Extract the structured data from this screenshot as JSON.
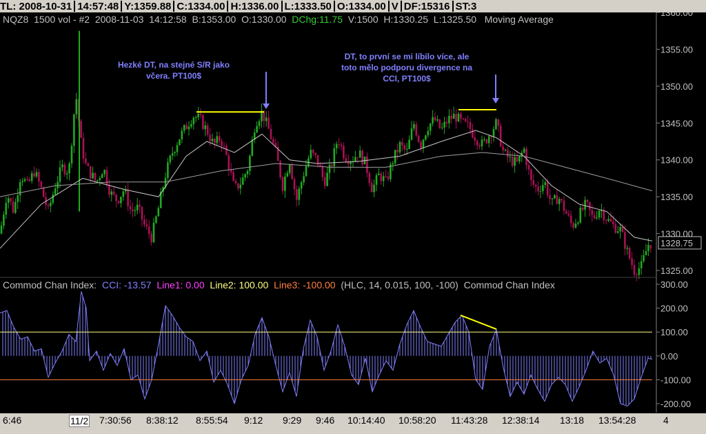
{
  "header": {
    "fields": [
      "TL: 2008-10-31",
      "14:57:48",
      "Y:1359.88",
      "C:1334.00",
      "H:1336.00",
      "L:1333.50",
      "O:1334.00",
      "V",
      "DF:15316",
      "ST:3"
    ]
  },
  "info": {
    "symbol": "NQZ8",
    "interval": "1500 vol - #2",
    "date": "2008-11-03",
    "time": "14:12:58",
    "bid": "B:1353.00",
    "open": "O:1330.00",
    "dchg": "DChg:11.75",
    "volume": "V:1500",
    "high": "H:1330.25",
    "low": "L:1325.50",
    "study": "Moving Average"
  },
  "cci_header": {
    "name": "Commod Chan Index:",
    "cci": "CCI: -13.57",
    "line1": "Line1: 0.00",
    "line2": "Line2: 100.00",
    "line3": "Line3: -100.00",
    "params": "(HLC, 14, 0.015, 100, -100)",
    "name2": "Commod Chan Index"
  },
  "annotations": {
    "left": [
      "Hezké DT, na stejné S/R jako",
      "včera. PT100$"
    ],
    "right": [
      "DT, to první se mi líbilo více, ale",
      "toto mělo podporu divergence na",
      "CCI, PT100$"
    ]
  },
  "colors": {
    "up": "#22aa22",
    "down": "#aa1155",
    "ma_fast": "#c8c8c8",
    "ma_slow": "#a0a0a0",
    "cci": "#8080ff",
    "line2": "#ffff80",
    "line3": "#ff8040",
    "annotation": "#8080ff",
    "dt_line": "#ffff00"
  },
  "chart_data": [
    {
      "type": "candlestick",
      "symbol": "NQZ8",
      "price_labels": [
        "1360.00",
        "1355.00",
        "1350.00",
        "1345.00",
        "1340.00",
        "1335.00",
        "1330.00",
        "1325.00"
      ],
      "price_ticks": [
        1360,
        1355,
        1350,
        1345,
        1340,
        1335,
        1330,
        1325
      ],
      "ylim": [
        1324,
        1360
      ],
      "last_price": "1328.75",
      "x_labels": [
        "6:46",
        "11/2",
        "7:30:56",
        "8:38:12",
        "8:55:54",
        "9:12",
        "9:29",
        "9:46",
        "10:14:40",
        "10:58:20",
        "11:43:28",
        "12:38:14",
        "13:18",
        "13:54:28",
        "4"
      ],
      "approx_close_path": [
        [
          0,
          1330.0
        ],
        [
          10,
          1335.5
        ],
        [
          20,
          1333.0
        ],
        [
          30,
          1338.0
        ],
        [
          40,
          1336.5
        ],
        [
          50,
          1338.5
        ],
        [
          60,
          1336.0
        ],
        [
          70,
          1333.0
        ],
        [
          80,
          1336.5
        ],
        [
          90,
          1339.0
        ],
        [
          100,
          1338.5
        ],
        [
          110,
          1349.0
        ],
        [
          118,
          1342.0
        ],
        [
          125,
          1339.0
        ],
        [
          140,
          1337.0
        ],
        [
          150,
          1339.0
        ],
        [
          160,
          1335.5
        ],
        [
          170,
          1334.5
        ],
        [
          180,
          1336.0
        ],
        [
          190,
          1333.0
        ],
        [
          200,
          1333.5
        ],
        [
          210,
          1331.0
        ],
        [
          220,
          1329.5
        ],
        [
          230,
          1333.5
        ],
        [
          240,
          1338.0
        ],
        [
          250,
          1341.0
        ],
        [
          260,
          1343.0
        ],
        [
          270,
          1344.5
        ],
        [
          280,
          1346.0
        ],
        [
          290,
          1345.5
        ],
        [
          300,
          1344.0
        ],
        [
          310,
          1342.0
        ],
        [
          320,
          1343.0
        ],
        [
          330,
          1340.0
        ],
        [
          340,
          1336.0
        ],
        [
          350,
          1337.0
        ],
        [
          360,
          1339.0
        ],
        [
          370,
          1345.0
        ],
        [
          380,
          1346.5
        ],
        [
          390,
          1344.0
        ],
        [
          400,
          1341.0
        ],
        [
          410,
          1336.5
        ],
        [
          420,
          1340.0
        ],
        [
          430,
          1334.5
        ],
        [
          440,
          1338.0
        ],
        [
          450,
          1341.0
        ],
        [
          460,
          1340.0
        ],
        [
          470,
          1337.0
        ],
        [
          480,
          1339.0
        ],
        [
          490,
          1343.0
        ],
        [
          500,
          1340.5
        ],
        [
          510,
          1340.0
        ],
        [
          520,
          1341.0
        ],
        [
          530,
          1339.5
        ],
        [
          540,
          1336.0
        ],
        [
          550,
          1338.0
        ],
        [
          560,
          1337.0
        ],
        [
          570,
          1340.0
        ],
        [
          580,
          1342.0
        ],
        [
          590,
          1341.0
        ],
        [
          600,
          1345.0
        ],
        [
          610,
          1342.0
        ],
        [
          620,
          1344.5
        ],
        [
          630,
          1345.5
        ],
        [
          640,
          1344.0
        ],
        [
          650,
          1345.5
        ],
        [
          660,
          1346.0
        ],
        [
          670,
          1345.0
        ],
        [
          680,
          1344.5
        ],
        [
          690,
          1343.0
        ],
        [
          700,
          1342.0
        ],
        [
          710,
          1343.5
        ],
        [
          720,
          1345.0
        ],
        [
          730,
          1341.0
        ],
        [
          740,
          1340.0
        ],
        [
          750,
          1339.5
        ],
        [
          760,
          1341.5
        ],
        [
          770,
          1337.0
        ],
        [
          780,
          1336.0
        ],
        [
          790,
          1337.0
        ],
        [
          800,
          1334.0
        ],
        [
          810,
          1335.0
        ],
        [
          820,
          1333.0
        ],
        [
          830,
          1331.0
        ],
        [
          840,
          1332.5
        ],
        [
          850,
          1334.0
        ],
        [
          860,
          1332.0
        ],
        [
          870,
          1333.5
        ],
        [
          880,
          1332.0
        ],
        [
          890,
          1331.0
        ],
        [
          900,
          1330.5
        ],
        [
          910,
          1327.5
        ],
        [
          920,
          1325.0
        ],
        [
          930,
          1325.5
        ],
        [
          940,
          1328.5
        ],
        [
          946,
          1328.75
        ]
      ],
      "ma_fast_path": [
        [
          0,
          1328.0
        ],
        [
          60,
          1334.0
        ],
        [
          120,
          1337.5
        ],
        [
          180,
          1336.0
        ],
        [
          230,
          1335.0
        ],
        [
          270,
          1340.5
        ],
        [
          300,
          1342.5
        ],
        [
          340,
          1341.0
        ],
        [
          380,
          1343.5
        ],
        [
          420,
          1340.0
        ],
        [
          460,
          1339.5
        ],
        [
          520,
          1339.8
        ],
        [
          580,
          1340.5
        ],
        [
          640,
          1342.5
        ],
        [
          690,
          1344.0
        ],
        [
          720,
          1343.0
        ],
        [
          760,
          1340.5
        ],
        [
          800,
          1336.5
        ],
        [
          840,
          1334.0
        ],
        [
          880,
          1333.0
        ],
        [
          920,
          1329.5
        ],
        [
          946,
          1329.0
        ]
      ],
      "ma_slow_path": [
        [
          0,
          1335.0
        ],
        [
          80,
          1336.5
        ],
        [
          160,
          1337.0
        ],
        [
          240,
          1337.0
        ],
        [
          320,
          1338.5
        ],
        [
          400,
          1339.5
        ],
        [
          480,
          1339.0
        ],
        [
          560,
          1339.0
        ],
        [
          640,
          1340.5
        ],
        [
          700,
          1341.0
        ],
        [
          760,
          1340.5
        ],
        [
          820,
          1339.0
        ],
        [
          880,
          1337.5
        ],
        [
          946,
          1335.8
        ]
      ],
      "double_tops": [
        {
          "from": [
            285,
            1346.5
          ],
          "to": [
            383,
            1346.5
          ]
        },
        {
          "from": [
            665,
            1346.8
          ],
          "to": [
            720,
            1346.8
          ]
        }
      ]
    },
    {
      "type": "bar",
      "name": "Commod Chan Index",
      "params": "(HLC, 14, 0.015, 100, -100)",
      "labels": [
        "300.00",
        "200.00",
        "100.00",
        "0.00",
        "-100.00",
        "-200.00"
      ],
      "ticks": [
        300,
        200,
        100,
        0,
        -100,
        -200
      ],
      "ylim": [
        -230,
        300
      ],
      "line1": 0,
      "line2": 100,
      "line3": -100,
      "cci_last": -13.57,
      "approx_path": [
        [
          0,
          180
        ],
        [
          10,
          190
        ],
        [
          20,
          120
        ],
        [
          30,
          70
        ],
        [
          40,
          80
        ],
        [
          50,
          20
        ],
        [
          60,
          30
        ],
        [
          70,
          -90
        ],
        [
          80,
          -30
        ],
        [
          90,
          20
        ],
        [
          100,
          90
        ],
        [
          110,
          60
        ],
        [
          118,
          270
        ],
        [
          125,
          200
        ],
        [
          130,
          -20
        ],
        [
          140,
          20
        ],
        [
          150,
          -60
        ],
        [
          160,
          10
        ],
        [
          170,
          -40
        ],
        [
          180,
          30
        ],
        [
          190,
          -100
        ],
        [
          200,
          -80
        ],
        [
          210,
          -180
        ],
        [
          220,
          -100
        ],
        [
          230,
          50
        ],
        [
          240,
          210
        ],
        [
          250,
          170
        ],
        [
          260,
          120
        ],
        [
          270,
          80
        ],
        [
          280,
          60
        ],
        [
          290,
          -20
        ],
        [
          300,
          20
        ],
        [
          310,
          -110
        ],
        [
          320,
          -60
        ],
        [
          330,
          -120
        ],
        [
          340,
          -200
        ],
        [
          350,
          -100
        ],
        [
          360,
          -40
        ],
        [
          370,
          90
        ],
        [
          380,
          160
        ],
        [
          390,
          80
        ],
        [
          400,
          -40
        ],
        [
          410,
          -150
        ],
        [
          420,
          -70
        ],
        [
          430,
          -170
        ],
        [
          440,
          30
        ],
        [
          450,
          150
        ],
        [
          460,
          80
        ],
        [
          470,
          -60
        ],
        [
          480,
          20
        ],
        [
          490,
          130
        ],
        [
          500,
          40
        ],
        [
          510,
          -80
        ],
        [
          520,
          -120
        ],
        [
          530,
          -10
        ],
        [
          540,
          -150
        ],
        [
          550,
          -80
        ],
        [
          560,
          -20
        ],
        [
          570,
          -60
        ],
        [
          580,
          50
        ],
        [
          590,
          130
        ],
        [
          600,
          190
        ],
        [
          610,
          120
        ],
        [
          620,
          60
        ],
        [
          630,
          50
        ],
        [
          640,
          40
        ],
        [
          650,
          90
        ],
        [
          660,
          140
        ],
        [
          670,
          170
        ],
        [
          680,
          100
        ],
        [
          690,
          -100
        ],
        [
          700,
          -140
        ],
        [
          710,
          40
        ],
        [
          720,
          110
        ],
        [
          730,
          -50
        ],
        [
          740,
          -170
        ],
        [
          750,
          -110
        ],
        [
          760,
          -160
        ],
        [
          770,
          -80
        ],
        [
          780,
          -140
        ],
        [
          790,
          -190
        ],
        [
          800,
          -120
        ],
        [
          810,
          -90
        ],
        [
          820,
          -120
        ],
        [
          830,
          -190
        ],
        [
          840,
          -130
        ],
        [
          850,
          -60
        ],
        [
          860,
          20
        ],
        [
          870,
          -30
        ],
        [
          880,
          -10
        ],
        [
          890,
          -80
        ],
        [
          900,
          -200
        ],
        [
          910,
          -210
        ],
        [
          920,
          -180
        ],
        [
          930,
          -90
        ],
        [
          940,
          -10
        ],
        [
          946,
          -14
        ]
      ],
      "divergence": {
        "from": [
          668,
          170
        ],
        "to": [
          720,
          112
        ]
      }
    }
  ]
}
